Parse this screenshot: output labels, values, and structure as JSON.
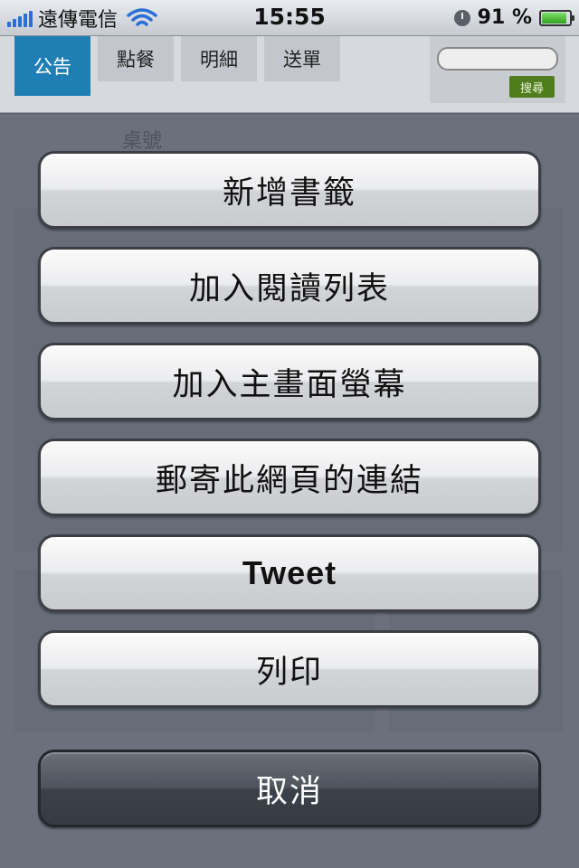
{
  "status_bar": {
    "carrier": "遠傳電信",
    "time": "15:55",
    "battery_percent": "91 %",
    "battery_level": 0.91,
    "icons": [
      "signal-icon",
      "wifi-icon",
      "clock-icon",
      "battery-icon"
    ]
  },
  "background_page": {
    "tabs": [
      {
        "label": "公告",
        "active": true
      },
      {
        "label": "點餐",
        "active": false
      },
      {
        "label": "明細",
        "active": false
      },
      {
        "label": "送單",
        "active": false
      }
    ],
    "search": {
      "value": "",
      "button_label": "搜尋"
    },
    "label": "桌號"
  },
  "action_sheet": {
    "actions": [
      {
        "label": "新增書籤"
      },
      {
        "label": "加入閱讀列表"
      },
      {
        "label": "加入主畫面螢幕"
      },
      {
        "label": "郵寄此網頁的連結"
      },
      {
        "label": "Tweet"
      },
      {
        "label": "列印"
      }
    ],
    "cancel_label": "取消"
  },
  "colors": {
    "active_tab": "#1f7fb4",
    "overlay": "#484e5c",
    "cancel_button": "#3b4049",
    "search_button": "#4f7d1e"
  }
}
